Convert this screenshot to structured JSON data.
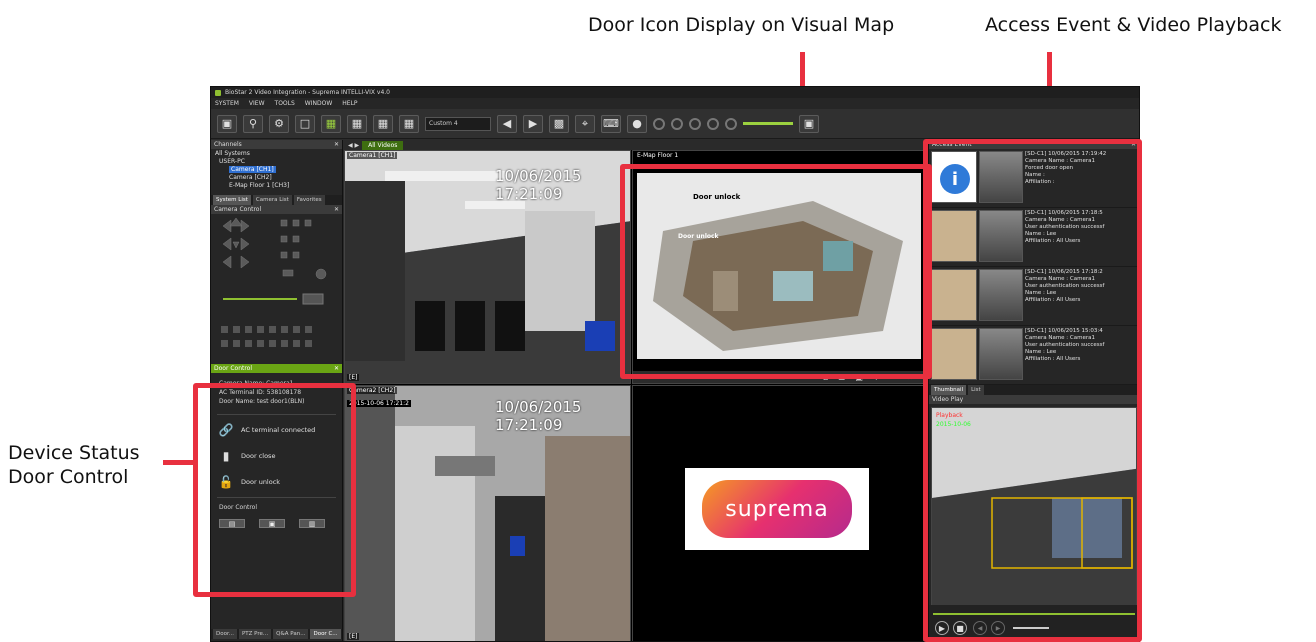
{
  "callouts": {
    "door_icon": "Door Icon Display on Visual Map",
    "access_event": "Access Event & Video Playback",
    "device_status_line1": "Device Status",
    "device_status_line2": "Door Control"
  },
  "app": {
    "title": "BioStar 2 Video Integration - Suprema INTELLI-VIX v4.0",
    "menu": [
      "SYSTEM",
      "VIEW",
      "TOOLS",
      "WINDOW",
      "HELP"
    ],
    "layout_select": "Custom 4"
  },
  "channels_panel": {
    "title": "Channels",
    "tree": [
      "All Systems",
      "USER-PC",
      "Camera [CH1]",
      "Camera [CH2]",
      "E-Map Floor 1 [CH3]"
    ],
    "tabs": [
      "System List",
      "Camera List",
      "Favorites"
    ]
  },
  "camera_control": {
    "title": "Camera Control"
  },
  "door_control": {
    "title": "Door Control",
    "camera_name_label": "Camera Name:",
    "camera_name_value": "Camera1",
    "terminal_label": "AC Terminal ID:",
    "terminal_value": "538108178",
    "door_name_label": "Door Name:",
    "door_name_value": "test door1(BLN)",
    "status_connected": "AC terminal connected",
    "status_close": "Door close",
    "status_unlock": "Door unlock",
    "section_title": "Door Control",
    "bottom_tabs": [
      "Door...",
      "PTZ Pre...",
      "Q&A Pan...",
      "Door C..."
    ]
  },
  "center": {
    "tab_label": "All Videos",
    "tile1_label": "Camera1 [CH1]",
    "tile1_time": "10/06/2015 17:21:09",
    "tile2_label": "E-Map Floor 1",
    "map_callout_1": "Door unlock",
    "map_callout_2": "Door unlock",
    "tile3_label": "Camera2 [CH2]",
    "tile3_time": "10/06/2015 17:21:09",
    "tile3_small": "2015-10-06 17:21:2",
    "logo_text": "suprema",
    "corner_label_1": "[E]",
    "corner_label_2": "[E]"
  },
  "access_event": {
    "title": "Access Event",
    "events": [
      {
        "line1": "[SD-C1] 10/06/2015 17:19:42",
        "line2": "Camera Name : Camera1",
        "line3": "Forced door open",
        "line4": "Name :",
        "line5": "Affiliation :"
      },
      {
        "line1": "[SD-C1] 10/06/2015 17:18:5",
        "line2": "Camera Name : Camera1",
        "line3": "User authentication successf",
        "line4": "Name : Lee",
        "line5": "Affiliation : All Users"
      },
      {
        "line1": "[SD-C1] 10/06/2015 17:18:2",
        "line2": "Camera Name : Camera1",
        "line3": "User authentication successf",
        "line4": "Name : Lee",
        "line5": "Affiliation : All Users"
      },
      {
        "line1": "[SD-C1] 10/06/2015 15:03:4",
        "line2": "Camera Name : Camera1",
        "line3": "User authentication successf",
        "line4": "Name : Lee",
        "line5": "Affiliation : All Users"
      }
    ],
    "tabs": [
      "Thumbnail",
      "List"
    ],
    "video_title": "Video Play",
    "play_red": "Playback",
    "play_green": "2015-10-06"
  },
  "colors": {
    "highlight": "#e8303f",
    "accent_green": "#8fc031",
    "panel_bg": "#2b2b2b"
  }
}
